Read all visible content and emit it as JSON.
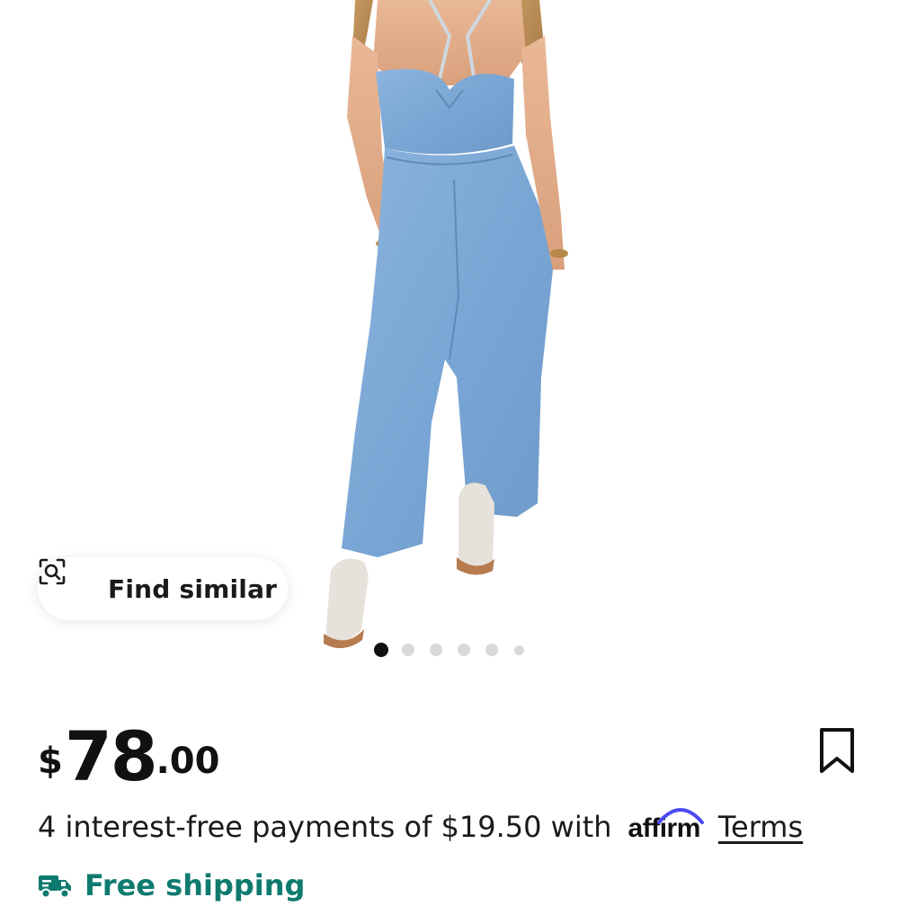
{
  "product": {
    "image_alt": "Woman wearing a light-wash denim halter jumpsuit with wide cropped legs and platform sandals",
    "gallery": {
      "total": 6,
      "active_index": 0
    }
  },
  "find_similar": {
    "label": "Find similar",
    "icon": "scan-search-icon"
  },
  "price": {
    "currency": "$",
    "whole": "78",
    "cents": ".00"
  },
  "installments": {
    "text": "4 interest-free payments of $19.50 with",
    "provider": "affirm",
    "terms_label": "Terms"
  },
  "shipping": {
    "label": "Free shipping",
    "icon": "truck-icon"
  },
  "colors": {
    "denim": "#7fa9d6",
    "shipping_green": "#0f7b6f",
    "affirm_arc": "#4a4af4",
    "dot_active": "#111111",
    "dot_inactive": "#d9d9d9"
  }
}
